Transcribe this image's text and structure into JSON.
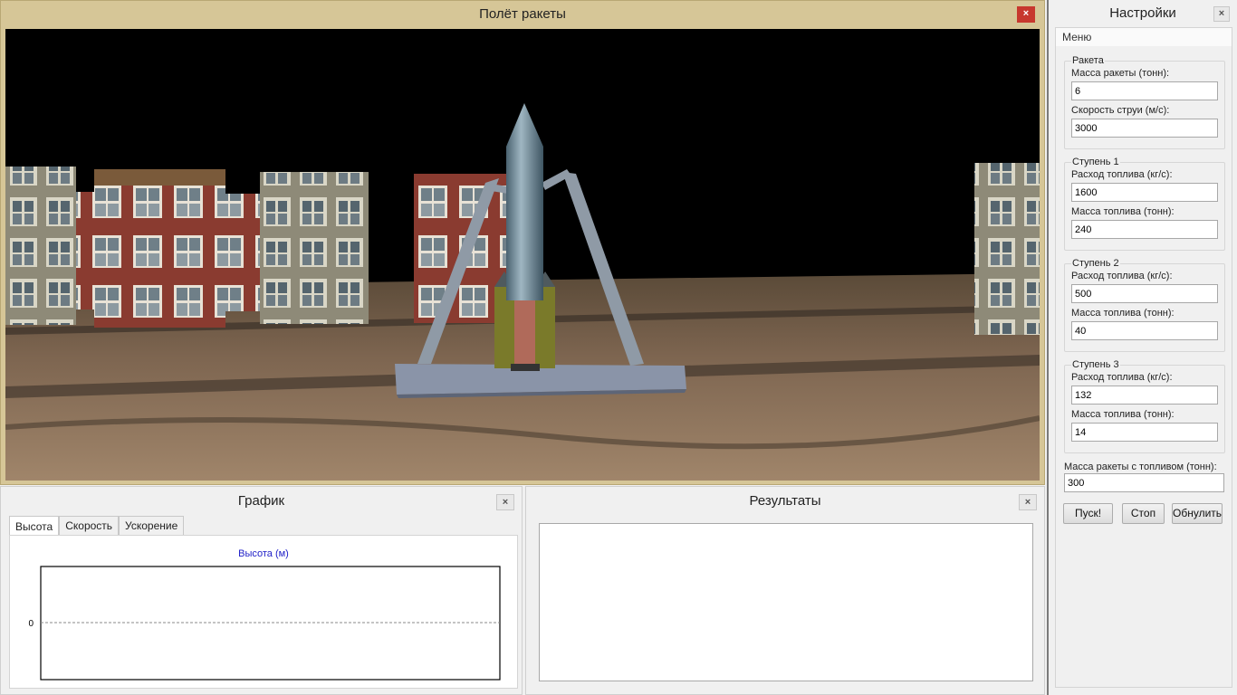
{
  "flight": {
    "title": "Полёт ракеты",
    "close": "×"
  },
  "graph": {
    "title": "График",
    "close": "×",
    "tabs": [
      "Высота",
      "Скорость",
      "Ускорение"
    ],
    "active_tab": 0,
    "chart_title": "Высота (м)"
  },
  "chart_data": {
    "type": "line",
    "title": "Высота (м)",
    "x": [],
    "series": [
      {
        "values": []
      }
    ],
    "y_tick_labels": [
      "0"
    ],
    "grid": false
  },
  "results": {
    "title": "Результаты",
    "close": "×",
    "text": ""
  },
  "settings": {
    "title": "Настройки",
    "close": "×",
    "menu": "Меню",
    "rocket": {
      "legend": "Ракета",
      "mass_label": "Масса ракеты (тонн):",
      "mass_value": "6",
      "jet_label": "Скорость струи (м/с):",
      "jet_value": "3000"
    },
    "stage1": {
      "legend": "Ступень 1",
      "flow_label": "Расход топлива (кг/с):",
      "flow_value": "1600",
      "fuel_label": "Масса топлива (тонн):",
      "fuel_value": "240"
    },
    "stage2": {
      "legend": "Ступень 2",
      "flow_label": "Расход топлива (кг/с):",
      "flow_value": "500",
      "fuel_label": "Масса топлива (тонн):",
      "fuel_value": "40"
    },
    "stage3": {
      "legend": "Ступень 3",
      "flow_label": "Расход топлива (кг/с):",
      "flow_value": "132",
      "fuel_label": "Масса топлива (тонн):",
      "fuel_value": "14"
    },
    "total_label": "Масса ракеты с топливом (тонн):",
    "total_value": "300",
    "buttons": {
      "start": "Пуск!",
      "stop": "Стоп",
      "reset": "Обнулить"
    }
  },
  "colors": {
    "title_bar": "#d6c697",
    "close_red": "#c7382e",
    "chart_title": "#2020c8"
  }
}
